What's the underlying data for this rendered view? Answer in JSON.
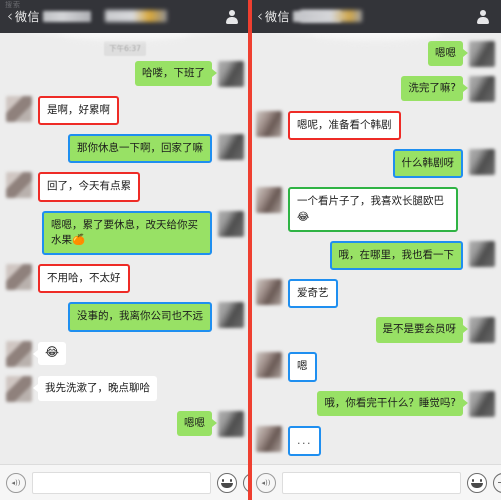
{
  "app": {
    "name": "WeChat",
    "status_text": "搜索",
    "divider_color": "#ef3f30",
    "bubble_green": "#98e165",
    "bubble_white": "#ffffff",
    "background": "#ededed",
    "header_background": "#333439"
  },
  "panels": [
    {
      "id": "left",
      "header": {
        "back_label": "‹",
        "title": "微信",
        "blurred_name": "",
        "contact_icon": "person-icon"
      },
      "timestamp": "下午6:37",
      "messages": [
        {
          "side": "right",
          "text": "哈喽，下班了",
          "bubble": "green",
          "border": "none",
          "avatar": "cool"
        },
        {
          "side": "left",
          "text": "是啊，好累啊",
          "bubble": "white",
          "border": "red",
          "avatar": "warm"
        },
        {
          "side": "right",
          "text": "那你休息一下啊，回家了嘛",
          "bubble": "green",
          "border": "blue",
          "avatar": "cool"
        },
        {
          "side": "left",
          "text": "回了，今天有点累",
          "bubble": "white",
          "border": "red",
          "avatar": "warm"
        },
        {
          "side": "right",
          "text": "嗯嗯，累了要休息，改天给你买水果🍊",
          "bubble": "green",
          "border": "blue",
          "avatar": "cool"
        },
        {
          "side": "left",
          "text": "不用哈，不太好",
          "bubble": "white",
          "border": "red",
          "avatar": "warm"
        },
        {
          "side": "right",
          "text": "没事的，我离你公司也不远",
          "bubble": "green",
          "border": "blue",
          "avatar": "cool"
        },
        {
          "side": "left",
          "text": "😂",
          "bubble": "white",
          "border": "none",
          "avatar": "warm",
          "is_emoji": true
        },
        {
          "side": "left",
          "text": "我先洗漱了，晚点聊哈",
          "bubble": "white",
          "border": "none",
          "avatar": "warm"
        },
        {
          "side": "right",
          "text": "嗯嗯",
          "bubble": "green",
          "border": "none",
          "avatar": "cool"
        }
      ],
      "input": {
        "voice_icon": "voice-icon",
        "placeholder": "",
        "value": "",
        "emoji_icon": "smiley-icon",
        "plus_icon": "plus-icon"
      }
    },
    {
      "id": "right",
      "header": {
        "back_label": "‹",
        "title": "微信",
        "blurred_name": "",
        "contact_icon": "person-icon"
      },
      "timestamp": "",
      "messages": [
        {
          "side": "right",
          "text": "嗯嗯",
          "bubble": "green",
          "border": "none",
          "avatar": "cool"
        },
        {
          "side": "right",
          "text": "洗完了嘛?",
          "bubble": "green",
          "border": "none",
          "avatar": "cool"
        },
        {
          "side": "left",
          "text": "嗯呢，准备看个韩剧",
          "bubble": "white",
          "border": "red",
          "avatar": "warm2"
        },
        {
          "side": "right",
          "text": "什么韩剧呀",
          "bubble": "green",
          "border": "blue",
          "avatar": "cool"
        },
        {
          "side": "left",
          "text": "一个看片子了，我喜欢长腿欧巴😂",
          "bubble": "white",
          "border": "green",
          "avatar": "warm2"
        },
        {
          "side": "right",
          "text": "哦，在哪里，我也看一下",
          "bubble": "green",
          "border": "blue",
          "avatar": "cool"
        },
        {
          "side": "left",
          "text": "爱奇艺",
          "bubble": "white",
          "border": "blue",
          "avatar": "warm2"
        },
        {
          "side": "right",
          "text": "是不是要会员呀",
          "bubble": "green",
          "border": "none",
          "avatar": "cool"
        },
        {
          "side": "left",
          "text": "嗯",
          "bubble": "white",
          "border": "blue",
          "avatar": "warm2"
        },
        {
          "side": "right",
          "text": "哦，你看完干什么？睡觉吗?",
          "bubble": "green",
          "border": "none",
          "avatar": "cool"
        },
        {
          "side": "left",
          "text": "...",
          "bubble": "white",
          "border": "blue",
          "avatar": "warm2",
          "is_dots": true
        }
      ],
      "input": {
        "voice_icon": "voice-icon",
        "placeholder": "",
        "value": "",
        "emoji_icon": "smiley-icon",
        "plus_icon": "plus-icon"
      }
    }
  ]
}
